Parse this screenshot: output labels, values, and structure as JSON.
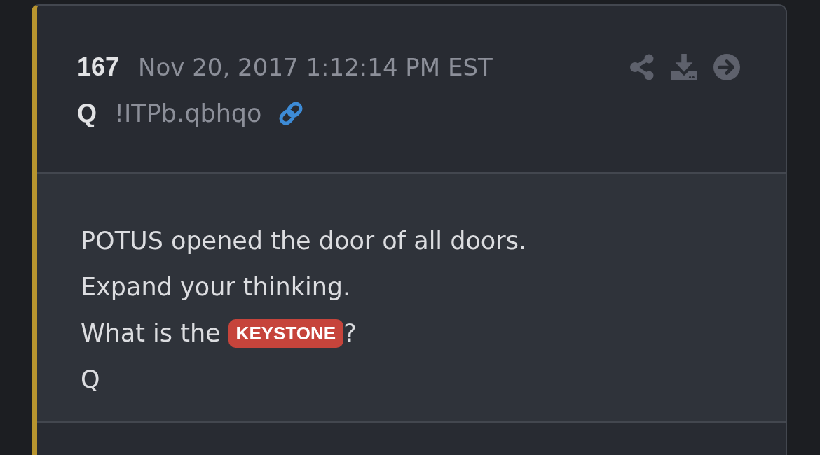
{
  "post": {
    "number": "167",
    "timestamp": "Nov 20, 2017 1:12:14 PM EST",
    "author": "Q",
    "tripcode": "!ITPb.qbhqo"
  },
  "body": [
    {
      "parts": [
        {
          "kind": "text",
          "text": "POTUS opened the door of all doors."
        }
      ]
    },
    {
      "parts": [
        {
          "kind": "text",
          "text": "Expand your thinking."
        }
      ]
    },
    {
      "parts": [
        {
          "kind": "text",
          "text": "What is the"
        },
        {
          "kind": "tag",
          "text": "KEYSTONE"
        },
        {
          "kind": "text",
          "text": "?"
        }
      ]
    },
    {
      "parts": [
        {
          "kind": "text",
          "text": "Q"
        }
      ]
    }
  ]
}
